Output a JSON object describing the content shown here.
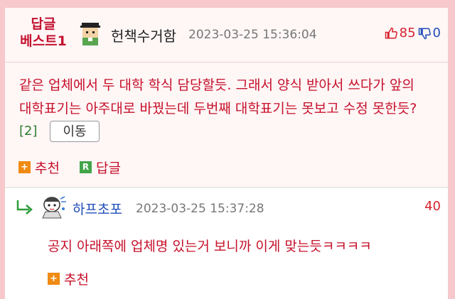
{
  "best_comment": {
    "label_line1": "답글",
    "label_line2": "베스트1",
    "nickname": "헌책수거함",
    "datetime": "2023-03-25 15:36:04",
    "upvotes": "85",
    "downvotes": "0",
    "body_line1": "같은 업체에서 두 대학 학식 담당할듯. 그래서 양식 받아서 쓰다가 앞의",
    "body_line2": "대학표기는 아주대로 바꿨는데 두번째 대학표기는 못보고 수정 못한듯?",
    "ref_count": "[2]",
    "move_label": "이동",
    "recommend_label": "추천",
    "reply_label": "답글",
    "reply_badge": "R"
  },
  "reply": {
    "nickname": "하프초포",
    "datetime": "2023-03-25 15:37:28",
    "count": "40",
    "body": "공지 아래쪽에 업체명 있는거 보니까 이게 맞는듯ㅋㅋㅋㅋ",
    "recommend_label": "추천"
  },
  "colors": {
    "accent_red": "#c5102a",
    "nick_blue": "#1f4db7",
    "frame_pink": "#f7c9cc",
    "plus_orange": "#f08a14",
    "r_green": "#42a549"
  },
  "icons": {
    "upvote": "thumbs-up-icon",
    "downvote": "thumbs-down-icon",
    "reply_arrow": "reply-arrow-icon",
    "plus": "plus-icon"
  }
}
